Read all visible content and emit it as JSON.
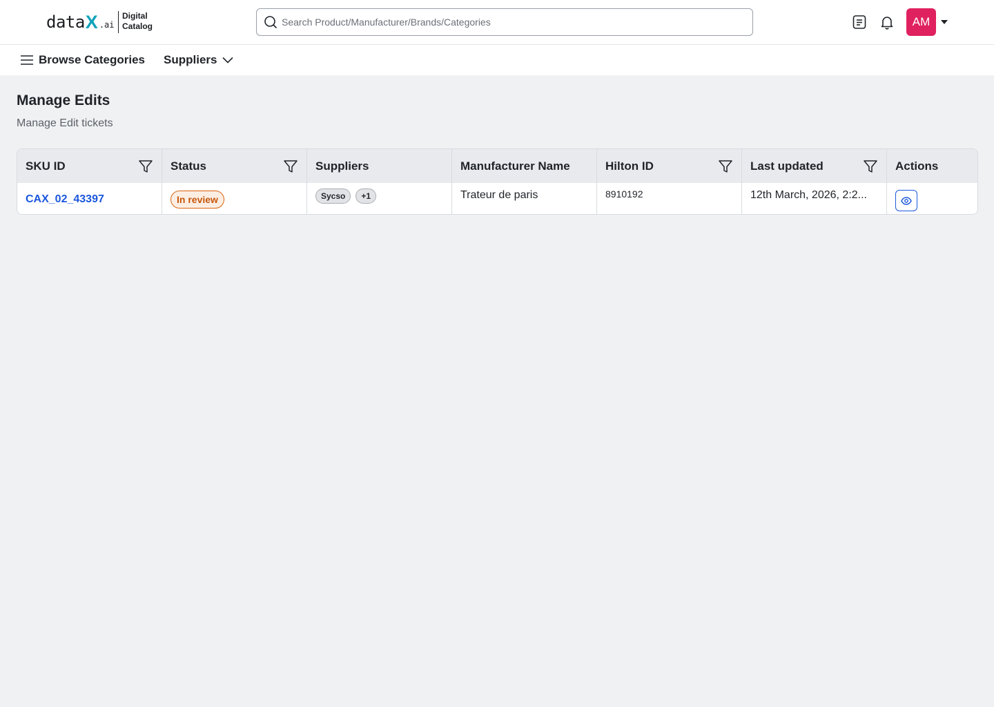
{
  "brand": {
    "word": "data",
    "x": "X",
    "suffix": ".ai",
    "sub_line1": "Digital",
    "sub_line2": "Catalog"
  },
  "search": {
    "placeholder": "Search Product/Manufacturer/Brands/Categories",
    "value": ""
  },
  "header_icons": [
    "document-icon",
    "bell-icon"
  ],
  "user": {
    "initials": "AM",
    "color": "#e0215f"
  },
  "nav": {
    "browse_label": "Browse Categories",
    "suppliers_label": "Suppliers"
  },
  "page": {
    "title": "Manage Edits",
    "subtitle": "Manage Edit tickets"
  },
  "table": {
    "columns": [
      {
        "label": "SKU ID",
        "filter": true
      },
      {
        "label": "Status",
        "filter": true
      },
      {
        "label": "Suppliers",
        "filter": false
      },
      {
        "label": "Manufacturer Name",
        "filter": false
      },
      {
        "label": "Hilton ID",
        "filter": true
      },
      {
        "label": "Last updated",
        "filter": true
      },
      {
        "label": "Actions",
        "filter": false
      }
    ],
    "rows": [
      {
        "sku_id": "CAX_02_43397",
        "status": "In review",
        "suppliers": [
          "Sycso"
        ],
        "suppliers_more": "+1",
        "manufacturer": "Trateur de paris",
        "hilton_id": "8910192",
        "last_updated": "12th March, 2026, 2:2...",
        "action_icon": "eye-icon"
      }
    ]
  },
  "colors": {
    "accent": "#1a56db",
    "status_review": "#c4570d",
    "logo_x": "#0fa3b9"
  }
}
